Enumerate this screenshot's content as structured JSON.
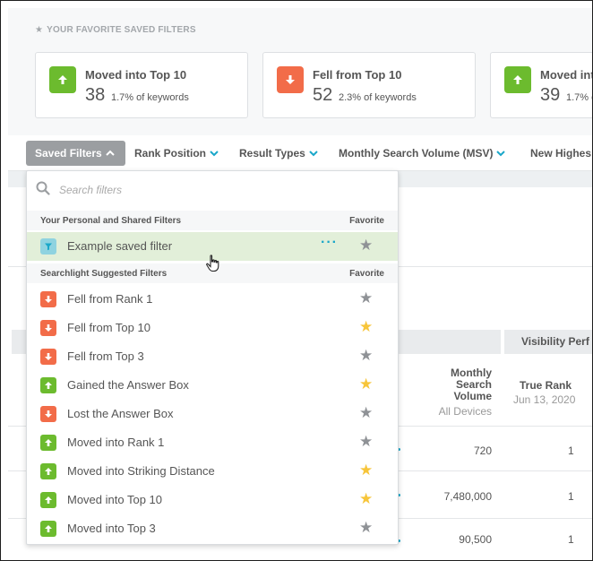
{
  "favorites": {
    "title": "YOUR FAVORITE SAVED FILTERS",
    "cards": [
      {
        "name": "Moved into Top 10",
        "count": "38",
        "pct": "1.7% of keywords",
        "direction": "up"
      },
      {
        "name": "Fell from Top 10",
        "count": "52",
        "pct": "2.3% of keywords",
        "direction": "down"
      },
      {
        "name": "Moved int",
        "count": "39",
        "pct": "1.7% o",
        "direction": "up"
      }
    ]
  },
  "toolbar": {
    "saved_filters": "Saved Filters",
    "rank_position": "Rank Position",
    "result_types": "Result Types",
    "msv": "Monthly Search Volume (MSV)",
    "new_highest": "New Highes"
  },
  "dropdown": {
    "search_placeholder": "Search filters",
    "personal_header": "Your Personal and Shared Filters",
    "suggested_header": "Searchlight Suggested Filters",
    "favorite_label": "Favorite",
    "personal_items": [
      {
        "label": "Example saved filter",
        "icon": "filter-icon",
        "starred": false
      }
    ],
    "suggested_items": [
      {
        "label": "Fell from Rank 1",
        "direction": "down",
        "starred": false
      },
      {
        "label": "Fell from Top 10",
        "direction": "down",
        "starred": true
      },
      {
        "label": "Fell from Top 3",
        "direction": "down",
        "starred": false
      },
      {
        "label": "Gained the Answer Box",
        "direction": "up",
        "starred": true
      },
      {
        "label": "Lost the Answer Box",
        "direction": "down",
        "starred": false
      },
      {
        "label": "Moved into Rank 1",
        "direction": "up",
        "starred": false
      },
      {
        "label": "Moved into Striking Distance",
        "direction": "up",
        "starred": true
      },
      {
        "label": "Moved into Top 10",
        "direction": "up",
        "starred": true
      },
      {
        "label": "Moved into Top 3",
        "direction": "up",
        "starred": false
      }
    ]
  },
  "table": {
    "visibility_header": "Visibility Perf",
    "msv_header_line1": "Monthly",
    "msv_header_line2": "Search",
    "msv_header_line3": "Volume",
    "msv_sub": "All Devices",
    "true_rank_header": "True Rank",
    "true_rank_sub": "Jun 13, 2020",
    "rows": [
      {
        "msv": "720",
        "rank": "1"
      },
      {
        "msv": "7,480,000",
        "rank": "1"
      },
      {
        "msv": "90,500",
        "rank": "1"
      }
    ]
  },
  "colors": {
    "up": "#6cbb2e",
    "down": "#f26c49",
    "accent": "#1aa7c9",
    "star_gold": "#f7c53a",
    "highlight": "#e2efd9"
  }
}
